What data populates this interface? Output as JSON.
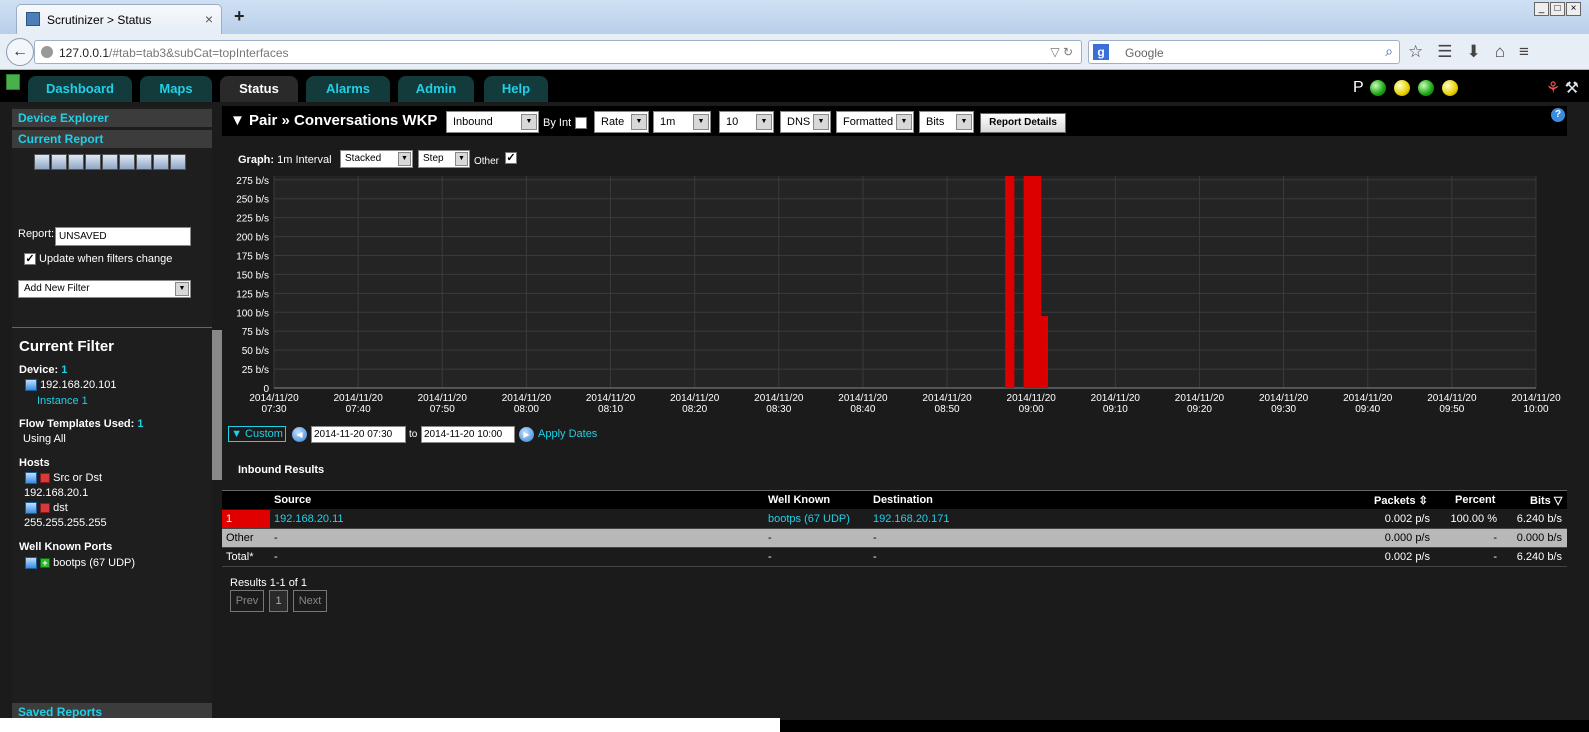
{
  "browser": {
    "tab_title": "Scrutinizer > Status",
    "new_tab": "+",
    "url_host": "127.0.0.1",
    "url_rest": "/#tab=tab3&subCat=topInterfaces",
    "search_placeholder": "Google"
  },
  "app_tabs": [
    {
      "label": "Dashboard",
      "active": false
    },
    {
      "label": "Maps",
      "active": false
    },
    {
      "label": "Status",
      "active": true
    },
    {
      "label": "Alarms",
      "active": false
    },
    {
      "label": "Admin",
      "active": false
    },
    {
      "label": "Help",
      "active": false
    }
  ],
  "status_indicator": "P",
  "sidebar": {
    "device_explorer": "Device Explorer",
    "current_report": "Current Report",
    "report_label": "Report:",
    "report_value": "UNSAVED",
    "update_label": "Update when filters change",
    "add_filter": "Add New Filter",
    "current_filter_title": "Current Filter",
    "device_label": "Device:",
    "device_count": "1",
    "device_ip": "192.168.20.101",
    "device_instance": "Instance 1",
    "flow_label": "Flow Templates Used:",
    "flow_count": "1",
    "flow_value": "Using All",
    "hosts_label": "Hosts",
    "host1_type": "Src or Dst",
    "host1_ip": "192.168.20.1",
    "host2_type": "dst",
    "host2_ip": "255.255.255.255",
    "ports_label": "Well Known Ports",
    "port1": "bootps (67 UDP)",
    "saved_reports": "Saved Reports"
  },
  "main": {
    "title": "▼ Pair » Conversations WKP",
    "direction": "Inbound",
    "by_int": "By Int",
    "rate": "Rate",
    "interval": "1m",
    "count": "10",
    "dns": "DNS",
    "format": "Formatted",
    "unit": "Bits",
    "report_details": "Report Details"
  },
  "graph": {
    "label": "Graph:",
    "interval_label": "1m Interval",
    "mode": "Stacked",
    "style": "Step",
    "other_label": "Other"
  },
  "chart_data": {
    "type": "bar",
    "ytick_labels": [
      "0",
      "25 b/s",
      "50 b/s",
      "75 b/s",
      "100 b/s",
      "125 b/s",
      "150 b/s",
      "175 b/s",
      "200 b/s",
      "225 b/s",
      "250 b/s",
      "275 b/s"
    ],
    "ylim": [
      0,
      280
    ],
    "xlim_minutes": [
      0,
      150
    ],
    "xtick_labels": [
      [
        "2014/11/20",
        "07:30"
      ],
      [
        "2014/11/20",
        "07:40"
      ],
      [
        "2014/11/20",
        "07:50"
      ],
      [
        "2014/11/20",
        "08:00"
      ],
      [
        "2014/11/20",
        "08:10"
      ],
      [
        "2014/11/20",
        "08:20"
      ],
      [
        "2014/11/20",
        "08:30"
      ],
      [
        "2014/11/20",
        "08:40"
      ],
      [
        "2014/11/20",
        "08:50"
      ],
      [
        "2014/11/20",
        "09:00"
      ],
      [
        "2014/11/20",
        "09:10"
      ],
      [
        "2014/11/20",
        "09:20"
      ],
      [
        "2014/11/20",
        "09:30"
      ],
      [
        "2014/11/20",
        "09:40"
      ],
      [
        "2014/11/20",
        "09:50"
      ],
      [
        "2014/11/20",
        "10:00"
      ]
    ],
    "bars": [
      {
        "start": 86.9,
        "end": 88.0,
        "value": 280
      },
      {
        "start": 89.1,
        "end": 91.2,
        "value": 280
      },
      {
        "start": 91.2,
        "end": 92.0,
        "value": 95
      }
    ],
    "series_color": "#dd0000",
    "grid": true
  },
  "dates": {
    "custom": "▼ Custom",
    "from": "2014-11-20 07:30",
    "to_label": "to",
    "to": "2014-11-20 10:00",
    "apply": "Apply Dates"
  },
  "results": {
    "title": "Inbound Results",
    "headers": {
      "source": "Source",
      "well_known": "Well Known",
      "destination": "Destination",
      "packets": "Packets",
      "percent": "Percent",
      "bits": "Bits"
    },
    "rows": [
      {
        "rank": "1",
        "source": "192.168.20.11",
        "well_known": "bootps (67 UDP)",
        "destination": "192.168.20.171",
        "packets": "0.002 p/s",
        "percent": "100.00 %",
        "bits": "6.240 b/s"
      },
      {
        "rank": "Other",
        "source": "-",
        "well_known": "-",
        "destination": "-",
        "packets": "0.000 p/s",
        "percent": "-",
        "bits": "0.000 b/s"
      },
      {
        "rank": "Total*",
        "source": "-",
        "well_known": "-",
        "destination": "-",
        "packets": "0.002 p/s",
        "percent": "-",
        "bits": "6.240 b/s"
      }
    ],
    "pager_text": "Results 1-1 of 1",
    "prev": "Prev",
    "page": "1",
    "next": "Next"
  }
}
